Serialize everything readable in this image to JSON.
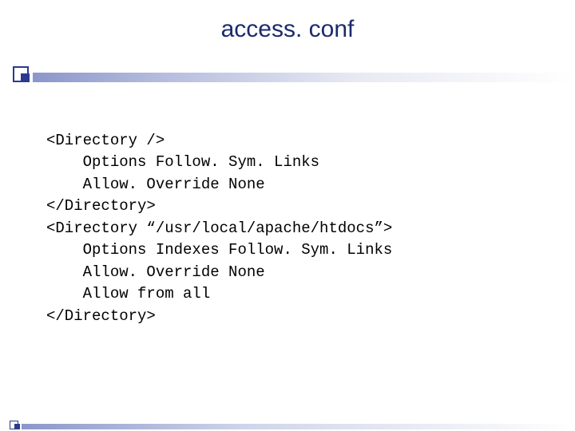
{
  "title": "access. conf",
  "code": {
    "lines": [
      "<Directory />",
      "    Options Follow. Sym. Links",
      "    Allow. Override None",
      "</Directory>",
      "<Directory “/usr/local/apache/htdocs”>",
      "    Options Indexes Follow. Sym. Links",
      "    Allow. Override None",
      "    Allow from all",
      "</Directory>"
    ]
  }
}
